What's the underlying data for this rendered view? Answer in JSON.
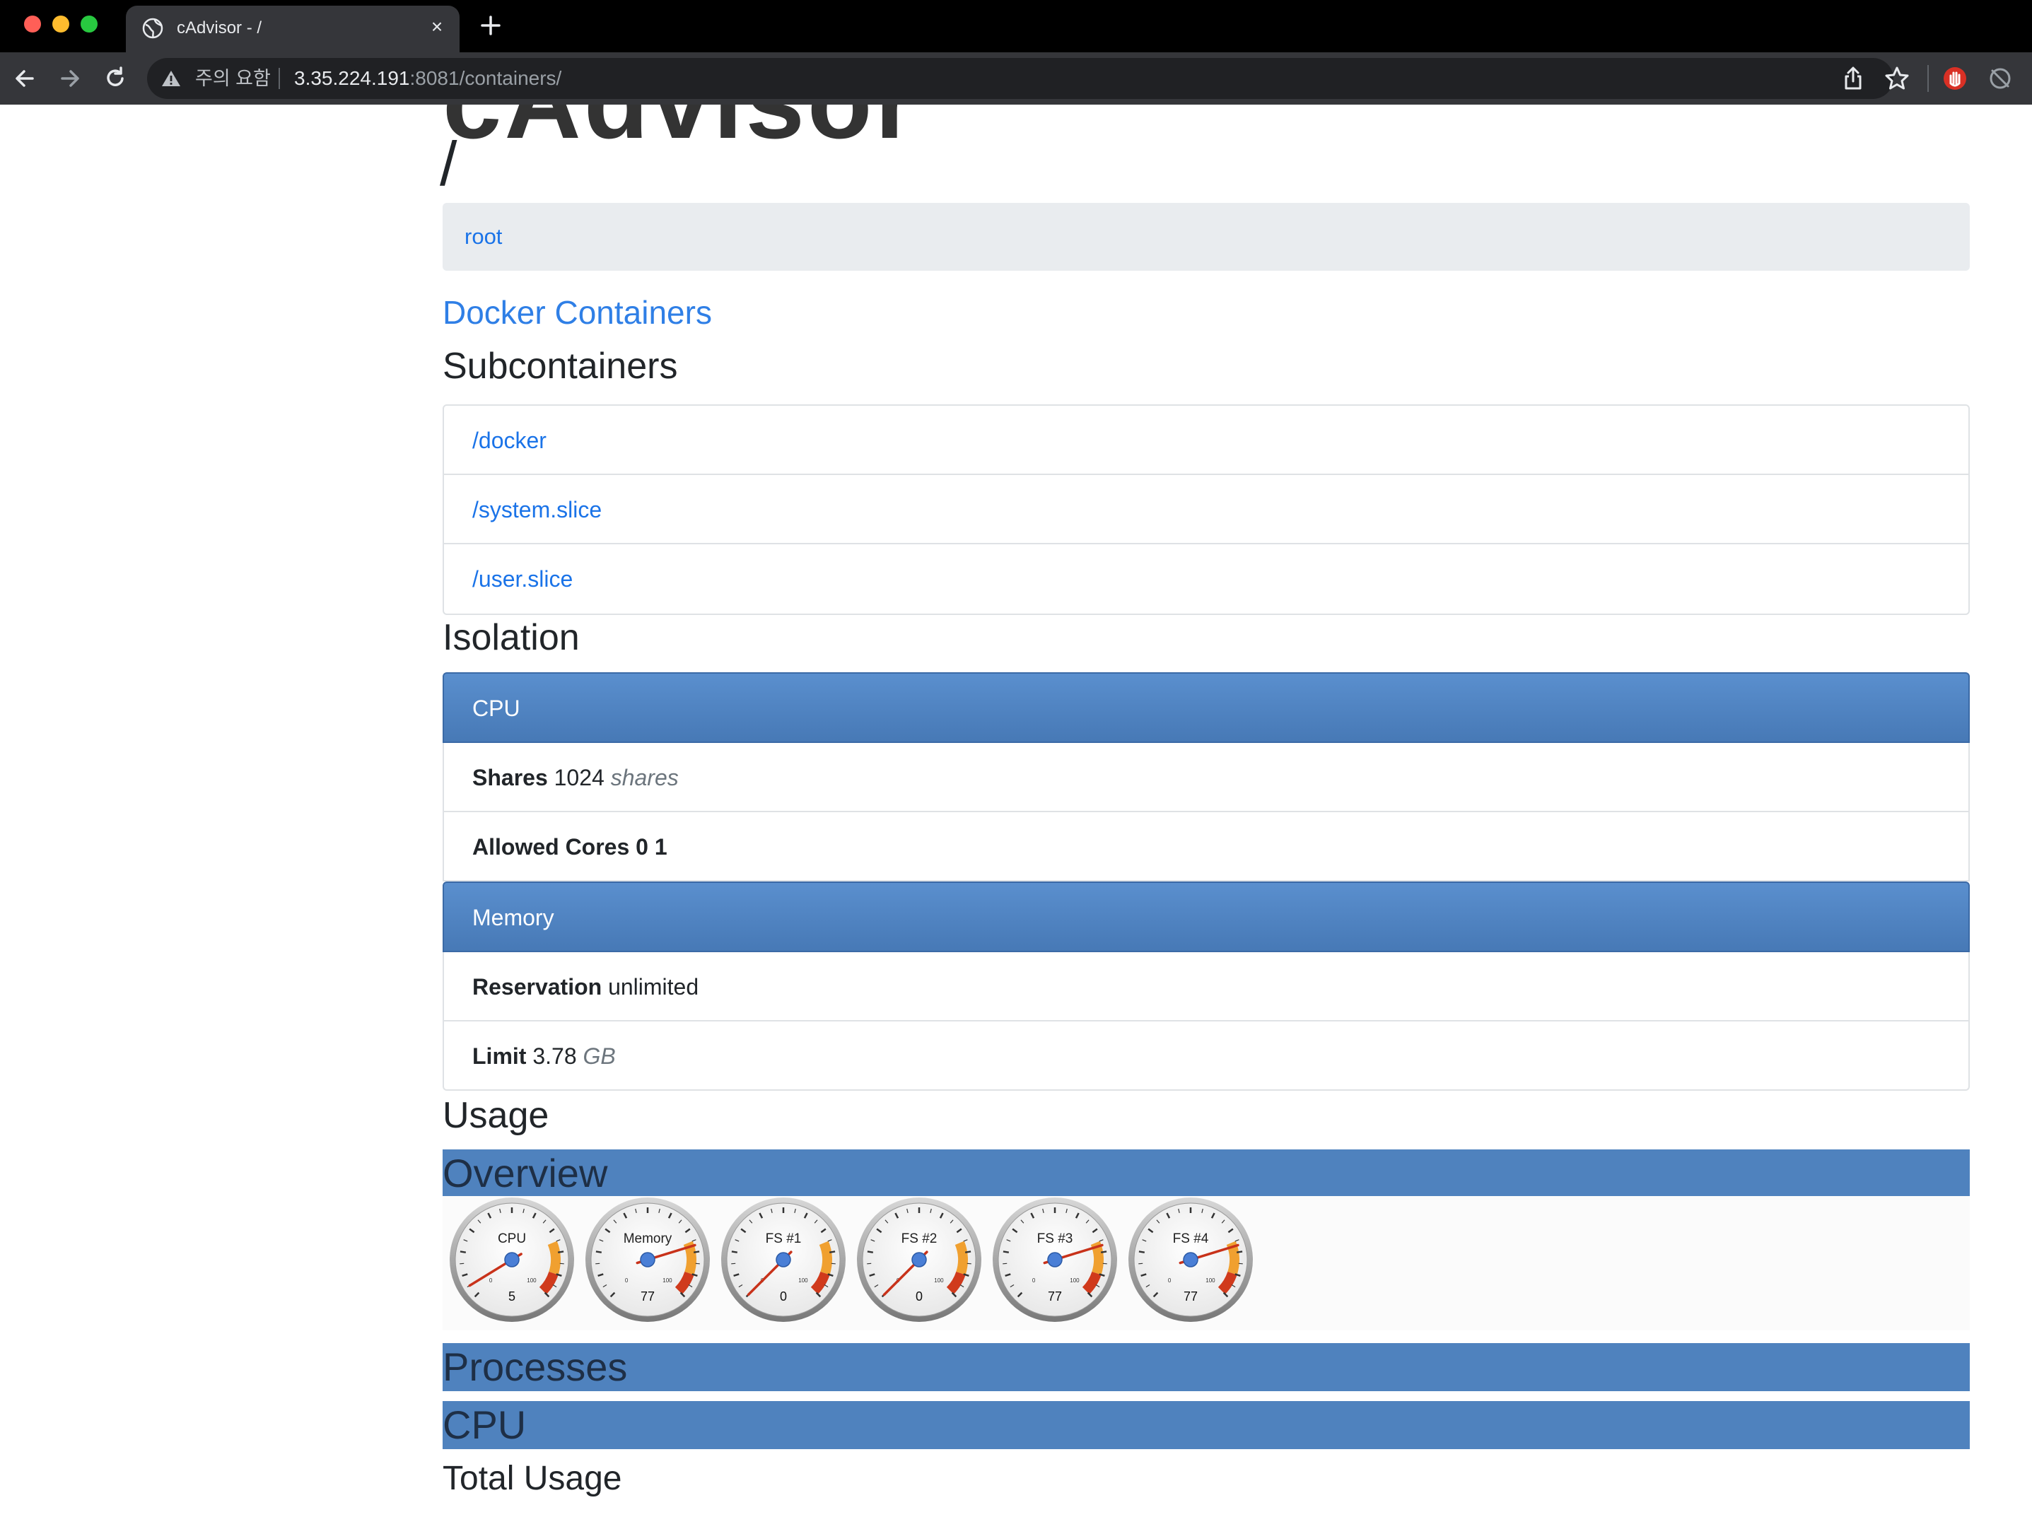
{
  "browser": {
    "tab_title": "cAdvisor - /",
    "tab_close": "×",
    "security_label": "주의 요함",
    "url_host": "3.35.224.191",
    "url_rest": ":8081/containers/"
  },
  "page": {
    "cut_title": "cAdvisor",
    "title": "/",
    "breadcrumb_root": "root",
    "docker_link": "Docker Containers",
    "subcontainers_heading": "Subcontainers",
    "subcontainers": [
      "/docker",
      "/system.slice",
      "/user.slice"
    ],
    "isolation_heading": "Isolation",
    "cpu_panel": {
      "title": "CPU",
      "shares_label": "Shares",
      "shares_value": "1024",
      "shares_unit": "shares",
      "cores_label": "Allowed Cores",
      "cores_value": "0 1"
    },
    "memory_panel": {
      "title": "Memory",
      "reservation_label": "Reservation",
      "reservation_value": "unlimited",
      "limit_label": "Limit",
      "limit_value": "3.78",
      "limit_unit": "GB"
    },
    "usage_heading": "Usage",
    "overview_band": "Overview",
    "processes_band": "Processes",
    "cpu_band": "CPU",
    "total_usage_heading": "Total Usage"
  },
  "gauges": [
    {
      "label": "CPU",
      "value": 5
    },
    {
      "label": "Memory",
      "value": 77
    },
    {
      "label": "FS #1",
      "value": 0
    },
    {
      "label": "FS #2",
      "value": 0
    },
    {
      "label": "FS #3",
      "value": 77
    },
    {
      "label": "FS #4",
      "value": 77
    }
  ],
  "gauge_scale": {
    "min_label": "0",
    "max_label": "100",
    "max": 100
  },
  "colors": {
    "panel_blue": "#4f82be",
    "link_blue": "#1a73e8",
    "gauge_orange": "#f0a030",
    "gauge_red": "#d03a1c"
  }
}
